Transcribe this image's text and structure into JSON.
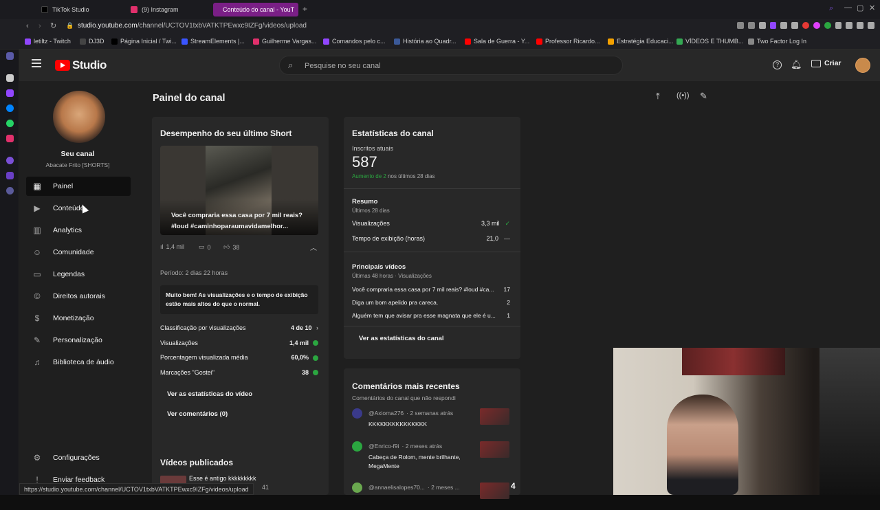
{
  "browser": {
    "tabs": [
      {
        "label": "TikTok Studio",
        "color": "#000000"
      },
      {
        "label": "(9) Instagram",
        "color": "#e1306c"
      },
      {
        "label": "Conteúdo do canal - YouT",
        "color": "#ff0000"
      }
    ],
    "url_host": "studio.youtube.com",
    "url_path": "/channel/UCTOV1txbVATKTPEwxc9IZFg/videos/upload",
    "bookmarks": [
      {
        "label": "letiltz - Twitch",
        "color": "#9146ff"
      },
      {
        "label": "DJ3D",
        "color": "#444444"
      },
      {
        "label": "Página Inicial / Twi...",
        "color": "#000000"
      },
      {
        "label": "StreamElements |...",
        "color": "#3a55ff"
      },
      {
        "label": "Guilherme Vargas...",
        "color": "#e1306c"
      },
      {
        "label": "Comandos pelo c...",
        "color": "#9146ff"
      },
      {
        "label": "História ao Quadr...",
        "color": "#3b5998"
      },
      {
        "label": "Sala de Guerra - Y...",
        "color": "#ff0000"
      },
      {
        "label": "Professor Ricardo...",
        "color": "#ff0000"
      },
      {
        "label": "Estratégia Educaci...",
        "color": "#f4a100"
      },
      {
        "label": "VÍDEOS E THUMB...",
        "color": "#34a853"
      },
      {
        "label": "Two Factor Log In",
        "color": "#888888"
      }
    ],
    "status_url": "https://studio.youtube.com/channel/UCTOV1txbVATKTPEwxc9IZFg/videos/upload"
  },
  "header": {
    "logo_text": "Studio",
    "search_placeholder": "Pesquise no seu canal",
    "create_label": "Criar"
  },
  "channel": {
    "title": "Seu canal",
    "name": "Abacate Frito [SHORTS]"
  },
  "nav": [
    {
      "label": "Painel",
      "icon": "dashboard-icon",
      "glyph": "▦"
    },
    {
      "label": "Conteúdo",
      "icon": "content-icon",
      "glyph": "▶"
    },
    {
      "label": "Analytics",
      "icon": "analytics-icon",
      "glyph": "▥"
    },
    {
      "label": "Comunidade",
      "icon": "community-icon",
      "glyph": "☺"
    },
    {
      "label": "Legendas",
      "icon": "subtitles-icon",
      "glyph": "▭"
    },
    {
      "label": "Direitos autorais",
      "icon": "copyright-icon",
      "glyph": "©"
    },
    {
      "label": "Monetização",
      "icon": "monetization-icon",
      "glyph": "$"
    },
    {
      "label": "Personalização",
      "icon": "customization-icon",
      "glyph": "✎"
    },
    {
      "label": "Biblioteca de áudio",
      "icon": "audio-library-icon",
      "glyph": "♫"
    }
  ],
  "nav_bottom": [
    {
      "label": "Configurações",
      "icon": "settings-icon",
      "glyph": "⚙"
    },
    {
      "label": "Enviar feedback",
      "icon": "feedback-icon",
      "glyph": "!"
    }
  ],
  "page_title": "Painel do canal",
  "short": {
    "heading": "Desempenho do seu último Short",
    "caption_line1": "Você compraria essa casa por 7 mil reais?",
    "caption_line2": "#loud #caminhoparaumavidamelhor...",
    "views": "1,4 mil",
    "comments": "0",
    "likes": "38",
    "period": "Período: 2 dias 22 horas",
    "highlight": "Muito bem! As visualizações e o tempo de exibição estão mais altos do que o normal.",
    "metrics": [
      {
        "label": "Classificação por visualizações",
        "value": "4 de 10"
      },
      {
        "label": "Visualizações",
        "value": "1,4 mil"
      },
      {
        "label": "Porcentagem visualizada média",
        "value": "60,0%"
      },
      {
        "label": "Marcações \"Gostei\"",
        "value": "38"
      }
    ],
    "link_stats": "Ver as estatísticas do vídeo",
    "link_comments": "Ver comentários (0)"
  },
  "published": {
    "heading": "Vídeos publicados",
    "first_item": "Esse é antigo kkkkkkkkk",
    "first_count": "41"
  },
  "stats": {
    "heading": "Estatísticas do canal",
    "subs_label": "Inscritos atuais",
    "subs_value": "587",
    "subs_growth": "Aumento de 2",
    "subs_growth_suffix": "nos últimos 28 dias",
    "summary_heading": "Resumo",
    "summary_period": "Últimos 28 dias",
    "summary_rows": [
      {
        "label": "Visualizações",
        "value": "3,3 mil",
        "trend": "✓"
      },
      {
        "label": "Tempo de exibição (horas)",
        "value": "21,0",
        "trend": "—"
      }
    ],
    "top_heading": "Principais vídeos",
    "top_period": "Últimas 48 horas · Visualizações",
    "top_videos": [
      {
        "title": "Você compraria essa casa por 7 mil reais? #loud #ca...",
        "views": "17"
      },
      {
        "title": "Diga um bom apelido pra careca.",
        "views": "2"
      },
      {
        "title": "Alguém tem que avisar pra esse magnata que ele é u...",
        "views": "1"
      }
    ],
    "link": "Ver as estatísticas do canal"
  },
  "comments": {
    "heading": "Comentários mais recentes",
    "subheading": "Comentários do canal que não respondi",
    "items": [
      {
        "author": "@Axioma276",
        "time": "· 2 semanas atrás",
        "text": "KKKKKKKKKKKKKKK",
        "avatar_color": "#3a3a8a"
      },
      {
        "author": "@Enrico-f9i",
        "time": "· 2 meses atrás",
        "text": "Cabeça de Rolom, mente brilhante, MegaMente",
        "avatar_color": "#2ba640"
      },
      {
        "author": "@annaelisalopes70...",
        "time": "· 2 meses ...",
        "text": "",
        "avatar_color": "#6aa84f"
      }
    ],
    "overlay_number": "4"
  }
}
